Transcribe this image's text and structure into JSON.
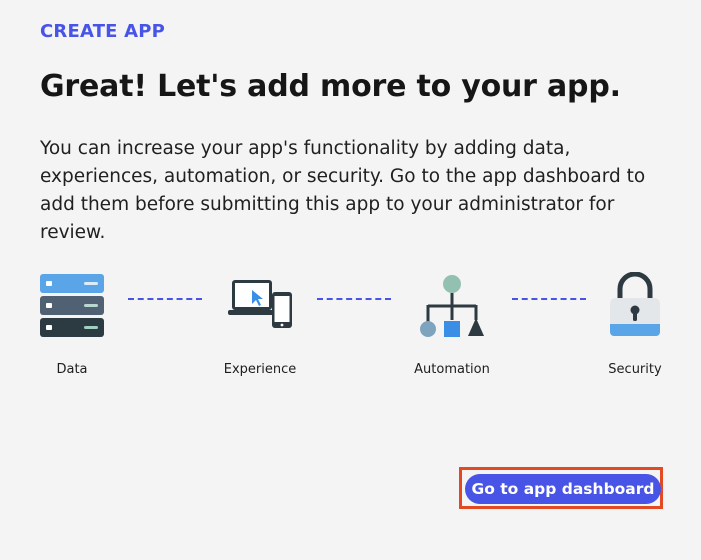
{
  "header": {
    "eyebrow": "CREATE APP",
    "title": "Great! Let's add more to your app."
  },
  "description": "You can increase your app's functionality by adding data, experiences, automation, or security. Go to the app dashboard to add them before submitting this app to your administrator for review.",
  "steps": [
    {
      "label": "Data",
      "icon": "database-icon"
    },
    {
      "label": "Experience",
      "icon": "devices-icon"
    },
    {
      "label": "Automation",
      "icon": "workflow-icon"
    },
    {
      "label": "Security",
      "icon": "lock-icon"
    }
  ],
  "actions": {
    "primary_label": "Go to app dashboard"
  },
  "colors": {
    "accent": "#4754e6",
    "highlight": "#e34a24",
    "background": "#f4f4f4"
  }
}
